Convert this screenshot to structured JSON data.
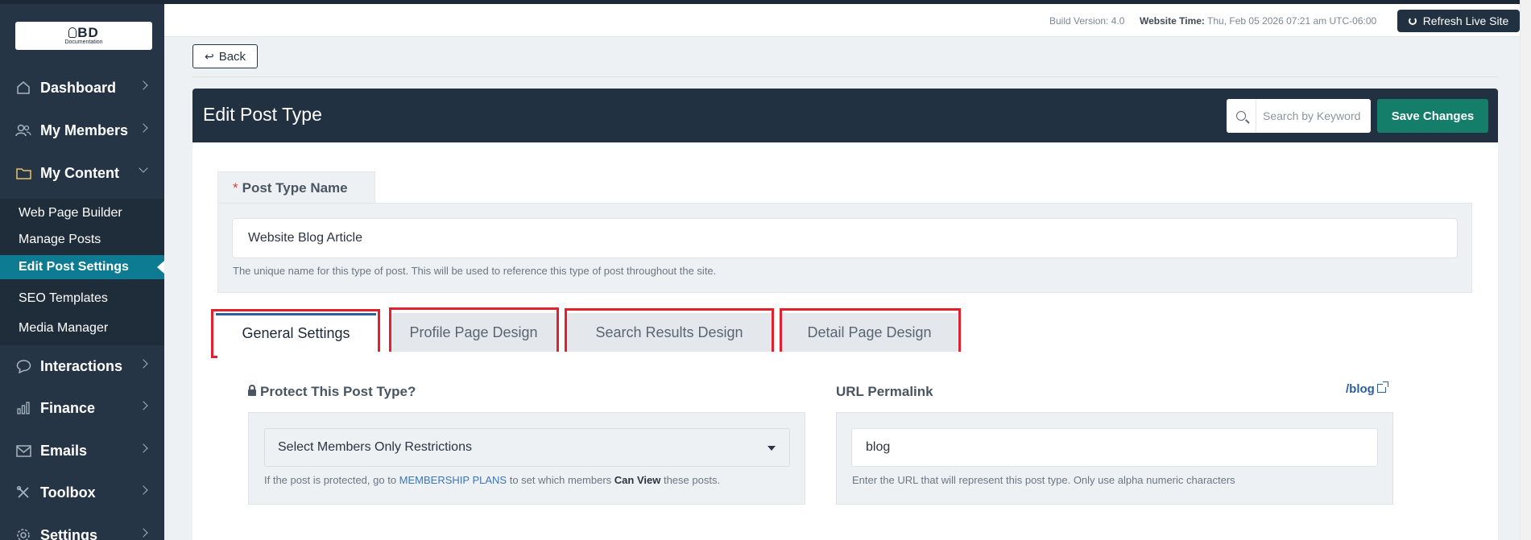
{
  "logo": {
    "main": "BD",
    "sub": "Documentation"
  },
  "sidebar": {
    "items": [
      {
        "label": "Dashboard",
        "icon": "home-icon"
      },
      {
        "label": "My Members",
        "icon": "users-icon"
      },
      {
        "label": "My Content",
        "icon": "folder-icon"
      },
      {
        "label": "Interactions",
        "icon": "chat-icon"
      },
      {
        "label": "Finance",
        "icon": "bar-chart-icon"
      },
      {
        "label": "Emails",
        "icon": "envelope-icon"
      },
      {
        "label": "Toolbox",
        "icon": "tools-icon"
      },
      {
        "label": "Settings",
        "icon": "gear-icon"
      }
    ],
    "sub_items": [
      {
        "label": "Web Page Builder"
      },
      {
        "label": "Manage Posts"
      },
      {
        "label": "Edit Post Settings"
      },
      {
        "label": "SEO Templates"
      },
      {
        "label": "Media Manager"
      }
    ]
  },
  "topbar": {
    "build_version": "Build Version: 4.0",
    "website_time_label": "Website Time:",
    "website_time_value": "Thu, Feb 05 2026 07:21 am UTC-06:00",
    "refresh_label": "Refresh Live Site"
  },
  "back_label": "Back",
  "header": {
    "title": "Edit Post Type",
    "search_placeholder": "Search by Keyword",
    "save_label": "Save Changes"
  },
  "post_type": {
    "required_mark": "*",
    "label": "Post Type Name",
    "value": "Website Blog Article",
    "help": "The unique name for this type of post. This will be used to reference this type of post throughout the site."
  },
  "tabs": [
    {
      "label": "General Settings",
      "active": true
    },
    {
      "label": "Profile Page Design",
      "active": false
    },
    {
      "label": "Search Results Design",
      "active": false
    },
    {
      "label": "Detail Page Design",
      "active": false
    }
  ],
  "protect": {
    "label": "Protect This Post Type?",
    "select_value": "Select Members Only Restrictions",
    "help_prefix": "If the post is protected, go to",
    "help_link": "MEMBERSHIP PLANS",
    "help_middle": "to set which members",
    "help_bold": "Can View",
    "help_suffix": "these posts."
  },
  "permalink": {
    "label": "URL Permalink",
    "link_text": "/blog",
    "value": "blog",
    "help": "Enter the URL that will represent this post type. Only use alpha numeric characters"
  },
  "colors": {
    "sidebar": "#263545",
    "active_item": "#0d7c92",
    "save_button": "#147e6b",
    "highlight": "#e2202e"
  }
}
